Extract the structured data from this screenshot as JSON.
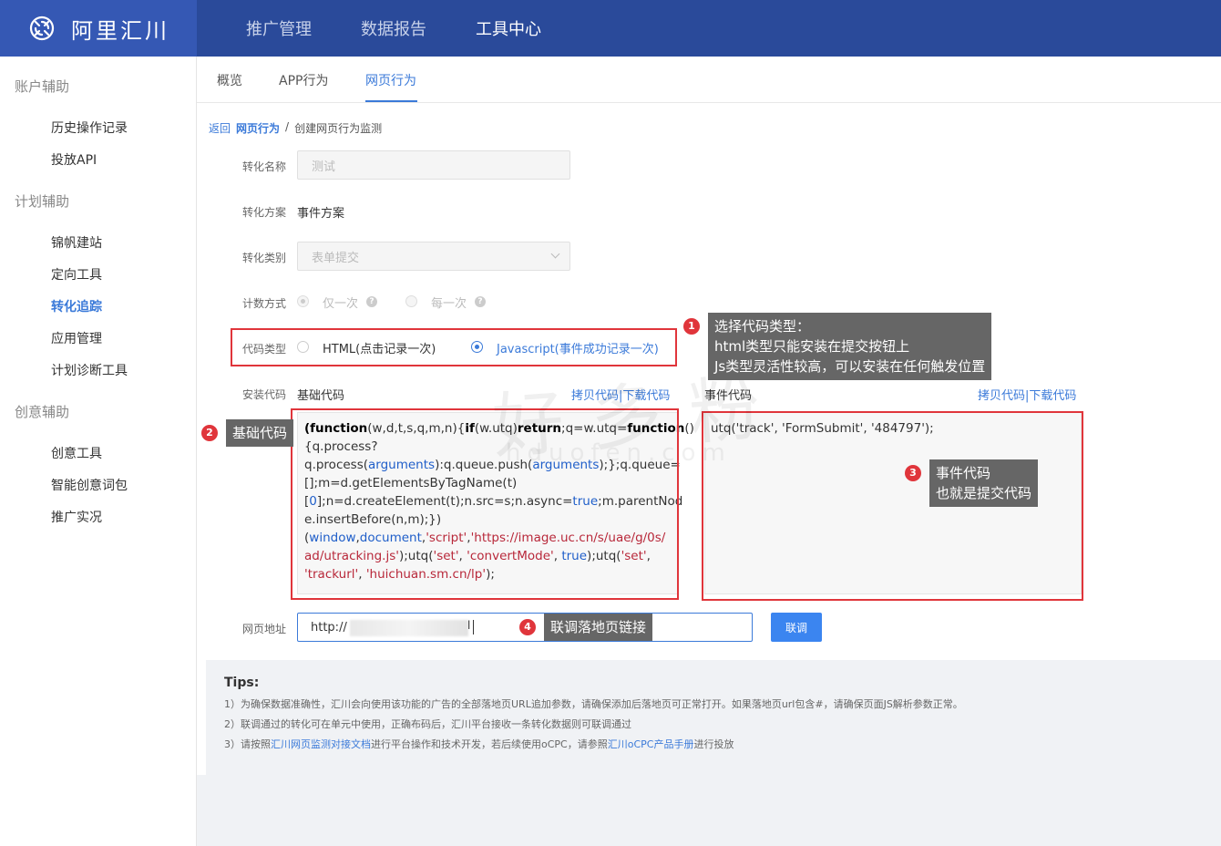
{
  "header": {
    "logo_text": "阿里汇川",
    "nav": [
      "推广管理",
      "数据报告",
      "工具中心"
    ]
  },
  "sidebar": {
    "groups": [
      {
        "title": "账户辅助",
        "items": [
          "历史操作记录",
          "投放API"
        ]
      },
      {
        "title": "计划辅助",
        "items": [
          "锦帆建站",
          "定向工具",
          "转化追踪",
          "应用管理",
          "计划诊断工具"
        ]
      },
      {
        "title": "创意辅助",
        "items": [
          "创意工具",
          "智能创意词包",
          "推广实况"
        ]
      }
    ],
    "active_item": "转化追踪"
  },
  "tabs": [
    "概览",
    "APP行为",
    "网页行为"
  ],
  "active_tab": "网页行为",
  "breadcrumb": {
    "back": "返回",
    "parent": "网页行为",
    "separator": "/",
    "current": "创建网页行为监测"
  },
  "form": {
    "name_label": "转化名称",
    "name_placeholder": "测试",
    "plan_label": "转化方案",
    "plan_value": "事件方案",
    "category_label": "转化类别",
    "category_value": "表单提交",
    "count_label": "计数方式",
    "count_once": "仅一次",
    "count_each": "每一次",
    "code_type_label": "代码类型",
    "code_type_html": "HTML(点击记录一次)",
    "code_type_js": "Javascript(事件成功记录一次)",
    "install_label": "安装代码",
    "base_code_title": "基础代码",
    "event_code_title": "事件代码",
    "copy_code": "拷贝代码",
    "download_code": "下载代码",
    "divider": "|",
    "event_code": "utq('track', 'FormSubmit', '484797');",
    "url_label": "网页地址",
    "url_value": "http://",
    "url_suffix": "l",
    "debug_button": "联调"
  },
  "annotations": {
    "a1_badge": "1",
    "a1_lines": [
      "选择代码类型：",
      "html类型只能安装在提交按钮上",
      "Js类型灵活性较高，可以安装在任何触发位置"
    ],
    "a2_badge": "2",
    "a2_text": "基础代码",
    "a3_badge": "3",
    "a3_lines": [
      "事件代码",
      "也就是提交代码"
    ],
    "a4_badge": "4",
    "a4_text": "联调落地页链接"
  },
  "tips": {
    "title": "Tips:",
    "line1": "1）为确保数据准确性，汇川会向使用该功能的广告的全部落地页URL追加参数，请确保添加后落地页可正常打开。如果落地页url包含#，请确保页面JS解析参数正常。",
    "line2": "2）联调通过的转化可在单元中使用，正确布码后，汇川平台接收一条转化数据则可联调通过",
    "line3_pre": "3）请按照",
    "line3_link1": "汇川网页监测对接文档",
    "line3_mid": "进行平台操作和技术开发，若后续使用oCPC，请参照",
    "line3_link2": "汇川oCPC产品手册",
    "line3_post": "进行投放"
  },
  "watermark": {
    "main": "好多粉",
    "sub": "hduofen.com"
  },
  "colors": {
    "header_bg": "#2a4a9a",
    "logo_bg": "#3558b4",
    "accent": "#3b7ad9",
    "annotation_red": "#e0353b",
    "callout_bg": "#666666"
  }
}
